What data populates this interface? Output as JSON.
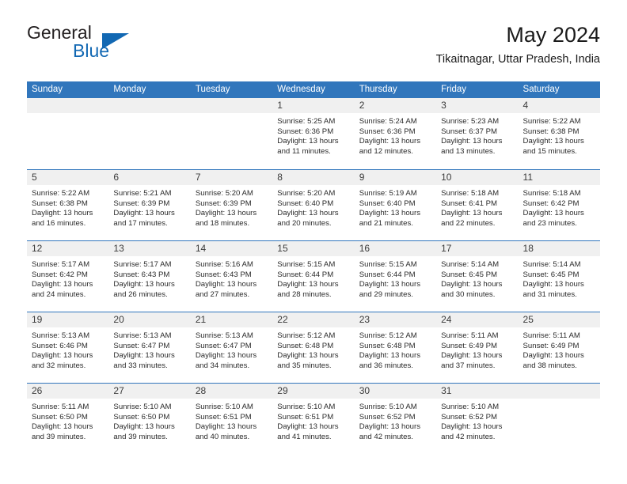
{
  "brand": {
    "name_part1": "General",
    "name_part2": "Blue",
    "accent_color": "#1268b3"
  },
  "header": {
    "title": "May 2024",
    "subtitle": "Tikaitnagar, Uttar Pradesh, India"
  },
  "theme": {
    "header_bar_color": "#3176bc",
    "day_band_color": "#f0f0f0",
    "text_color": "#2b2b2b"
  },
  "weekdays": [
    "Sunday",
    "Monday",
    "Tuesday",
    "Wednesday",
    "Thursday",
    "Friday",
    "Saturday"
  ],
  "labels": {
    "sunrise": "Sunrise:",
    "sunset": "Sunset:",
    "daylight": "Daylight:"
  },
  "weeks": [
    [
      {
        "day": "",
        "empty": true
      },
      {
        "day": "",
        "empty": true
      },
      {
        "day": "",
        "empty": true
      },
      {
        "day": "1",
        "sunrise": "Sunrise: 5:25 AM",
        "sunset": "Sunset: 6:36 PM",
        "daylight": "Daylight: 13 hours and 11 minutes."
      },
      {
        "day": "2",
        "sunrise": "Sunrise: 5:24 AM",
        "sunset": "Sunset: 6:36 PM",
        "daylight": "Daylight: 13 hours and 12 minutes."
      },
      {
        "day": "3",
        "sunrise": "Sunrise: 5:23 AM",
        "sunset": "Sunset: 6:37 PM",
        "daylight": "Daylight: 13 hours and 13 minutes."
      },
      {
        "day": "4",
        "sunrise": "Sunrise: 5:22 AM",
        "sunset": "Sunset: 6:38 PM",
        "daylight": "Daylight: 13 hours and 15 minutes."
      }
    ],
    [
      {
        "day": "5",
        "sunrise": "Sunrise: 5:22 AM",
        "sunset": "Sunset: 6:38 PM",
        "daylight": "Daylight: 13 hours and 16 minutes."
      },
      {
        "day": "6",
        "sunrise": "Sunrise: 5:21 AM",
        "sunset": "Sunset: 6:39 PM",
        "daylight": "Daylight: 13 hours and 17 minutes."
      },
      {
        "day": "7",
        "sunrise": "Sunrise: 5:20 AM",
        "sunset": "Sunset: 6:39 PM",
        "daylight": "Daylight: 13 hours and 18 minutes."
      },
      {
        "day": "8",
        "sunrise": "Sunrise: 5:20 AM",
        "sunset": "Sunset: 6:40 PM",
        "daylight": "Daylight: 13 hours and 20 minutes."
      },
      {
        "day": "9",
        "sunrise": "Sunrise: 5:19 AM",
        "sunset": "Sunset: 6:40 PM",
        "daylight": "Daylight: 13 hours and 21 minutes."
      },
      {
        "day": "10",
        "sunrise": "Sunrise: 5:18 AM",
        "sunset": "Sunset: 6:41 PM",
        "daylight": "Daylight: 13 hours and 22 minutes."
      },
      {
        "day": "11",
        "sunrise": "Sunrise: 5:18 AM",
        "sunset": "Sunset: 6:42 PM",
        "daylight": "Daylight: 13 hours and 23 minutes."
      }
    ],
    [
      {
        "day": "12",
        "sunrise": "Sunrise: 5:17 AM",
        "sunset": "Sunset: 6:42 PM",
        "daylight": "Daylight: 13 hours and 24 minutes."
      },
      {
        "day": "13",
        "sunrise": "Sunrise: 5:17 AM",
        "sunset": "Sunset: 6:43 PM",
        "daylight": "Daylight: 13 hours and 26 minutes."
      },
      {
        "day": "14",
        "sunrise": "Sunrise: 5:16 AM",
        "sunset": "Sunset: 6:43 PM",
        "daylight": "Daylight: 13 hours and 27 minutes."
      },
      {
        "day": "15",
        "sunrise": "Sunrise: 5:15 AM",
        "sunset": "Sunset: 6:44 PM",
        "daylight": "Daylight: 13 hours and 28 minutes."
      },
      {
        "day": "16",
        "sunrise": "Sunrise: 5:15 AM",
        "sunset": "Sunset: 6:44 PM",
        "daylight": "Daylight: 13 hours and 29 minutes."
      },
      {
        "day": "17",
        "sunrise": "Sunrise: 5:14 AM",
        "sunset": "Sunset: 6:45 PM",
        "daylight": "Daylight: 13 hours and 30 minutes."
      },
      {
        "day": "18",
        "sunrise": "Sunrise: 5:14 AM",
        "sunset": "Sunset: 6:45 PM",
        "daylight": "Daylight: 13 hours and 31 minutes."
      }
    ],
    [
      {
        "day": "19",
        "sunrise": "Sunrise: 5:13 AM",
        "sunset": "Sunset: 6:46 PM",
        "daylight": "Daylight: 13 hours and 32 minutes."
      },
      {
        "day": "20",
        "sunrise": "Sunrise: 5:13 AM",
        "sunset": "Sunset: 6:47 PM",
        "daylight": "Daylight: 13 hours and 33 minutes."
      },
      {
        "day": "21",
        "sunrise": "Sunrise: 5:13 AM",
        "sunset": "Sunset: 6:47 PM",
        "daylight": "Daylight: 13 hours and 34 minutes."
      },
      {
        "day": "22",
        "sunrise": "Sunrise: 5:12 AM",
        "sunset": "Sunset: 6:48 PM",
        "daylight": "Daylight: 13 hours and 35 minutes."
      },
      {
        "day": "23",
        "sunrise": "Sunrise: 5:12 AM",
        "sunset": "Sunset: 6:48 PM",
        "daylight": "Daylight: 13 hours and 36 minutes."
      },
      {
        "day": "24",
        "sunrise": "Sunrise: 5:11 AM",
        "sunset": "Sunset: 6:49 PM",
        "daylight": "Daylight: 13 hours and 37 minutes."
      },
      {
        "day": "25",
        "sunrise": "Sunrise: 5:11 AM",
        "sunset": "Sunset: 6:49 PM",
        "daylight": "Daylight: 13 hours and 38 minutes."
      }
    ],
    [
      {
        "day": "26",
        "sunrise": "Sunrise: 5:11 AM",
        "sunset": "Sunset: 6:50 PM",
        "daylight": "Daylight: 13 hours and 39 minutes."
      },
      {
        "day": "27",
        "sunrise": "Sunrise: 5:10 AM",
        "sunset": "Sunset: 6:50 PM",
        "daylight": "Daylight: 13 hours and 39 minutes."
      },
      {
        "day": "28",
        "sunrise": "Sunrise: 5:10 AM",
        "sunset": "Sunset: 6:51 PM",
        "daylight": "Daylight: 13 hours and 40 minutes."
      },
      {
        "day": "29",
        "sunrise": "Sunrise: 5:10 AM",
        "sunset": "Sunset: 6:51 PM",
        "daylight": "Daylight: 13 hours and 41 minutes."
      },
      {
        "day": "30",
        "sunrise": "Sunrise: 5:10 AM",
        "sunset": "Sunset: 6:52 PM",
        "daylight": "Daylight: 13 hours and 42 minutes."
      },
      {
        "day": "31",
        "sunrise": "Sunrise: 5:10 AM",
        "sunset": "Sunset: 6:52 PM",
        "daylight": "Daylight: 13 hours and 42 minutes."
      },
      {
        "day": "",
        "empty": true
      }
    ]
  ]
}
